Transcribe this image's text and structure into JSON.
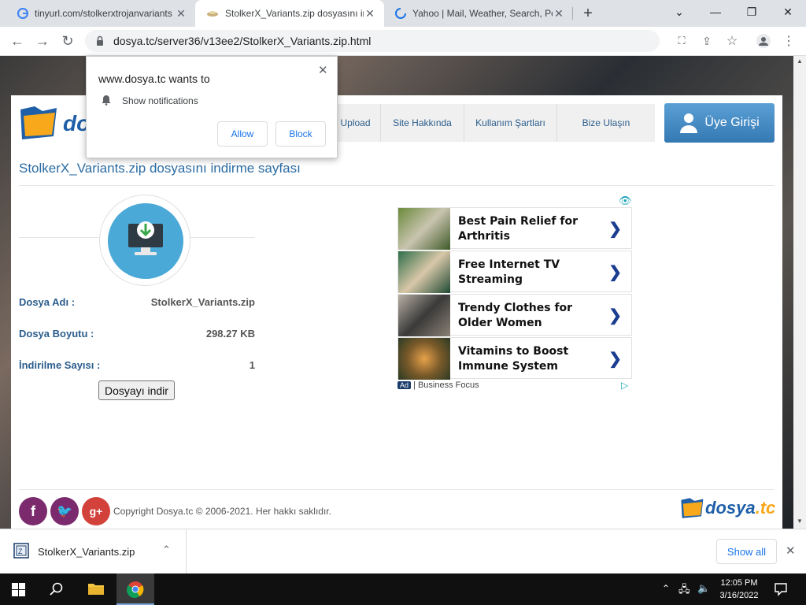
{
  "browser": {
    "tabs": [
      {
        "title": "tinyurl.com/stolkerxtrojanvariants",
        "icon": "google-g-icon"
      },
      {
        "title": "StolkerX_Variants.zip dosyasını ind",
        "icon": "site-favicon"
      },
      {
        "title": "Yahoo | Mail, Weather, Search, Po",
        "icon": "loading-spinner-icon"
      }
    ],
    "url": "dosya.tc/server36/v13ee2/StolkerX_Variants.zip.html"
  },
  "popup": {
    "origin_text": "www.dosya.tc wants to",
    "permission_text": "Show notifications",
    "allow_label": "Allow",
    "block_label": "Block"
  },
  "site": {
    "logo_text": "do",
    "nav": [
      "Upload",
      "Site Hakkında",
      "Kullanım Şartları",
      "Bize Ulaşın"
    ],
    "login_label": "Üye Girişi",
    "heading": "StolkerX_Variants.zip dosyasını indirme sayfası",
    "file": {
      "name_label": "Dosya Adı :",
      "name_value": "StolkerX_Variants.zip",
      "size_label": "Dosya Boyutu :",
      "size_value": "298.27 KB",
      "count_label": "İndirilme Sayısı :",
      "count_value": "1",
      "download_button": "Dosyayı indir"
    },
    "ads": [
      {
        "text": "Best Pain Relief for Arthritis"
      },
      {
        "text": "Free Internet TV Streaming"
      },
      {
        "text": "Trendy Clothes for Older Women"
      },
      {
        "text": "Vitamins to Boost Immune System"
      }
    ],
    "ad_source": "Business Focus",
    "ad_badge": "Ad",
    "footer_copy": "Copyright Dosya.tc © 2006-2021. Her hakkı saklıdır.",
    "footer_logo": "dosya",
    "footer_logo_tld": ".tc"
  },
  "download_bar": {
    "file_name": "StolkerX_Variants.zip",
    "show_all": "Show all"
  },
  "taskbar": {
    "time": "12:05 PM",
    "date": "3/16/2022"
  },
  "colors": {
    "accent_blue": "#2b6ca3",
    "chrome_blue": "#1a73e8",
    "login_blue": "#3579b4"
  }
}
